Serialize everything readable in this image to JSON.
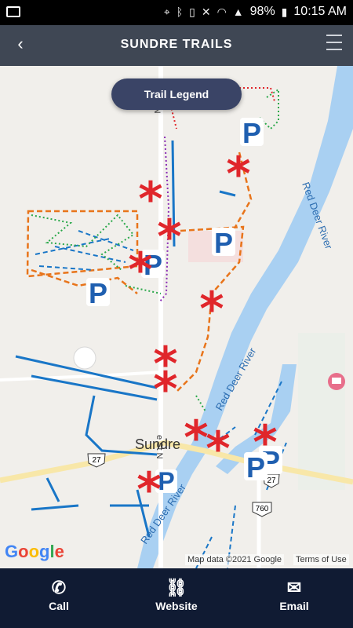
{
  "status": {
    "battery": "98%",
    "time": "10:15 AM",
    "icons": [
      "location-icon",
      "bluetooth-icon",
      "vibrate-icon",
      "mute-icon",
      "wifi-icon",
      "signal-icon",
      "battery-icon"
    ]
  },
  "header": {
    "title": "SUNDRE TRAILS",
    "back_icon": "back-icon",
    "menu_icon": "menu-icon"
  },
  "map": {
    "legend_button": "Trail Legend",
    "labels": {
      "river_north": "Red Deer River",
      "river_mid": "Red Deer River",
      "river_south": "Red Deer River",
      "town": "Sundre",
      "street": "e St N",
      "highway_27_left": "27",
      "highway_27_right": "27",
      "highway_760": "760",
      "street_north": "n St N"
    },
    "attribution": "Map data ©2021 Google",
    "terms": "Terms of Use",
    "google_logo": "Google"
  },
  "bottom_nav": {
    "call": "Call",
    "website": "Website",
    "email": "Email"
  }
}
